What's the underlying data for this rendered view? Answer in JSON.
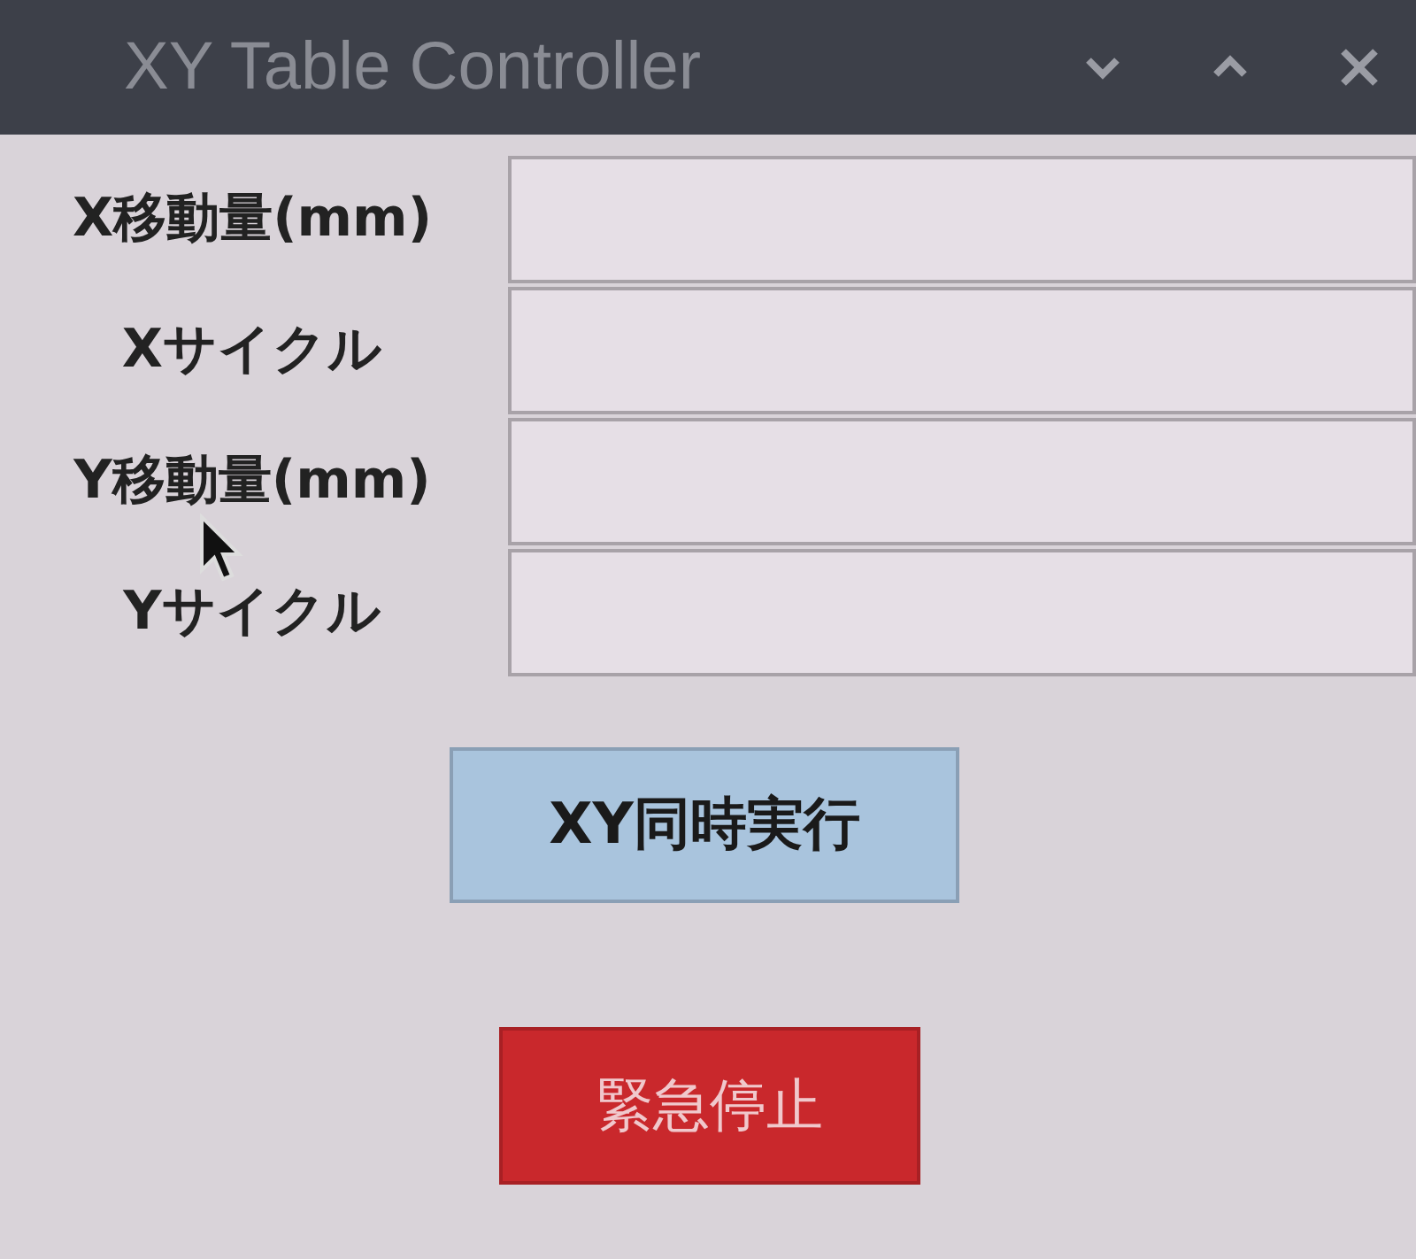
{
  "window": {
    "title": "XY Table Controller"
  },
  "fields": [
    {
      "label": "X移動量(mm)"
    },
    {
      "label": "Xサイクル"
    },
    {
      "label": "Y移動量(mm)"
    },
    {
      "label": "Yサイクル"
    }
  ],
  "buttons": [
    {
      "label": "XY同時実行",
      "kind": "run"
    },
    {
      "label": "緊急停止",
      "kind": "stop"
    }
  ]
}
